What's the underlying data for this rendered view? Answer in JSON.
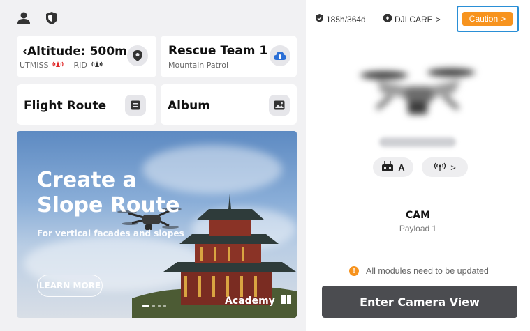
{
  "cards": {
    "altitude": {
      "title": "Altitude: 500m",
      "title_prefix": "‹",
      "utmiss_label": "UTMISS",
      "rid_label": "RID"
    },
    "team": {
      "title": "Rescue Team 1",
      "subtitle": "Mountain Patrol"
    },
    "flight_route": {
      "title": "Flight Route"
    },
    "album": {
      "title": "Album"
    }
  },
  "banner": {
    "headline": "Create a Slope Route",
    "description": "For vertical facades and slopes",
    "learn_more": "LEARN MORE",
    "academy": "Academy"
  },
  "status": {
    "hours": "185h/364d",
    "care": "DJI CARE",
    "care_chevron": ">",
    "caution": "Caution",
    "caution_chevron": ">"
  },
  "device": {
    "remote_mode": "A",
    "link_chevron": ">",
    "payload_name": "CAM",
    "payload_label": "Payload 1",
    "notice": "All modules need to be updated",
    "notice_icon": "!",
    "enter_button": "Enter Camera View"
  },
  "colors": {
    "accent_orange": "#f7931e",
    "focus_blue": "#2a8fd6",
    "signal_red": "#e02b2b",
    "button_dark": "#4b4c50"
  }
}
